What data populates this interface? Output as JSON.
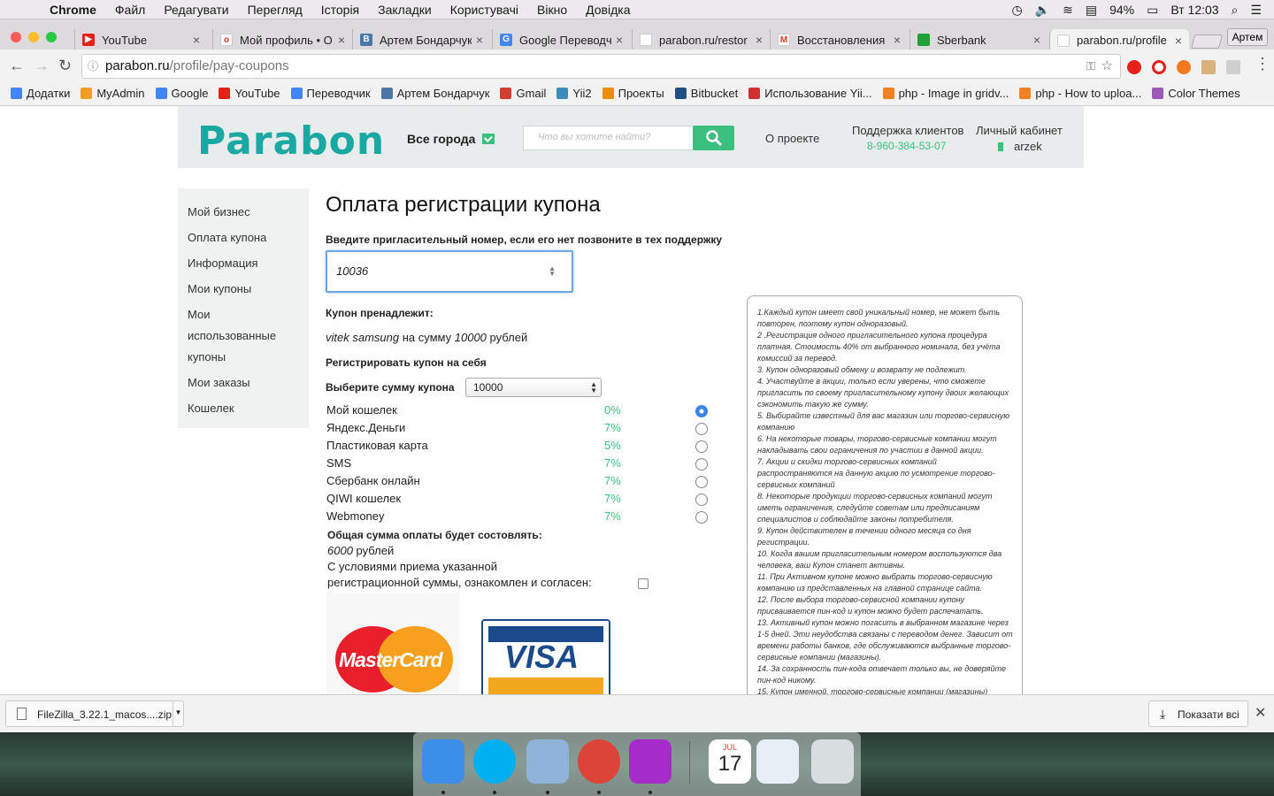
{
  "menubar": {
    "app": "Chrome",
    "items": [
      "Файл",
      "Редагувати",
      "Перегляд",
      "Історія",
      "Закладки",
      "Користувачі",
      "Вікно",
      "Довідка"
    ],
    "battery": "94%",
    "clock": "Вт 12:03"
  },
  "tabs": [
    {
      "label": "YouTube",
      "icon": "youtube-icon",
      "color": "#e62117",
      "glyph": "▶"
    },
    {
      "label": "Мой профиль • O",
      "icon": "olx-icon",
      "color": "#ffffff",
      "glyph": "o"
    },
    {
      "label": "Артем Бондарчук",
      "icon": "vk-icon",
      "color": "#4a76a8",
      "glyph": "В"
    },
    {
      "label": "Google Переводч",
      "icon": "google-translate-icon",
      "color": "#4285f4",
      "glyph": "G"
    },
    {
      "label": "parabon.ru/restor",
      "icon": "parabon-icon",
      "color": "#ffffff",
      "glyph": ""
    },
    {
      "label": "Восстановления",
      "icon": "gmail-icon",
      "color": "#ffffff",
      "glyph": "M"
    },
    {
      "label": "Sberbank",
      "icon": "sberbank-icon",
      "color": "#21a038",
      "glyph": ""
    },
    {
      "label": "parabon.ru/profile",
      "icon": "parabon-icon",
      "color": "#ffffff",
      "glyph": "",
      "active": true
    }
  ],
  "profile_button": "Артем",
  "address": {
    "host": "parabon.ru",
    "path": "/profile/pay-coupons"
  },
  "bookmarks": [
    {
      "label": "Додатки",
      "icon": "apps-icon",
      "color": "#4285f4"
    },
    {
      "label": "MyAdmin",
      "icon": "myadmin-icon",
      "color": "#f0a020"
    },
    {
      "label": "Google",
      "icon": "google-icon",
      "color": "#4285f4"
    },
    {
      "label": "YouTube",
      "icon": "youtube-icon",
      "color": "#e62117"
    },
    {
      "label": "Переводчик",
      "icon": "translate-icon",
      "color": "#4285f4"
    },
    {
      "label": "Артем Бондарчук",
      "icon": "vk-icon",
      "color": "#4a76a8"
    },
    {
      "label": "Gmail",
      "icon": "gmail-icon",
      "color": "#d23f31"
    },
    {
      "label": "Yii2",
      "icon": "yii-icon",
      "color": "#3c8dbc"
    },
    {
      "label": "Проекты",
      "icon": "stack-icon",
      "color": "#f08c00"
    },
    {
      "label": "Bitbucket",
      "icon": "bitbucket-icon",
      "color": "#205081"
    },
    {
      "label": "Использование Yii...",
      "icon": "sk-icon",
      "color": "#d0302f"
    },
    {
      "label": "php - Image in gridv...",
      "icon": "stackoverflow-icon",
      "color": "#f48024"
    },
    {
      "label": "php - How to uploa...",
      "icon": "stackoverflow-icon",
      "color": "#f48024"
    },
    {
      "label": "Color Themes",
      "icon": "color-themes-icon",
      "color": "#9b59b6"
    }
  ],
  "site": {
    "logo": "Parabon",
    "city": "Все города",
    "search_placeholder": "Что вы хотите найти?",
    "about": "О проекте",
    "support_label": "Поддержка клиентов",
    "support_phone": "8-960-384-53-07",
    "cabinet_label": "Личный кабинет",
    "username": "arzek"
  },
  "sidebar": [
    "Мой бизнес",
    "Оплата купона",
    "Информация",
    "Мои купоны",
    "Мои использованные купоны",
    "Мои заказы",
    "Кошелек"
  ],
  "form": {
    "title": "Оплата регистрации купона",
    "hint": "Введите пригласительный номер, если его нет позвоните в тех поддержку",
    "code_value": "10036",
    "owner_label": "Купон пренадлежит:",
    "owner_name": "vitek samsung",
    "owner_mid": "на сумму",
    "owner_amount": "10000",
    "owner_currency": "рублей",
    "self_register": "Регистрировать купон на себя",
    "amount_label": "Выберите сумму купона",
    "amount_value": "10000",
    "payments": [
      {
        "name": "Мой кошелек",
        "pct": "0%",
        "selected": true
      },
      {
        "name": "Яндекс.Деньги",
        "pct": "7%",
        "selected": false
      },
      {
        "name": "Пластиковая карта",
        "pct": "5%",
        "selected": false
      },
      {
        "name": "SMS",
        "pct": "7%",
        "selected": false
      },
      {
        "name": "Сбербанк онлайн",
        "pct": "7%",
        "selected": false
      },
      {
        "name": "QIWI кошелек",
        "pct": "7%",
        "selected": false
      },
      {
        "name": "Webmoney",
        "pct": "7%",
        "selected": false
      }
    ],
    "total_label": "Общая сумма оплаты будет состовлять:",
    "total_value": "6000",
    "total_currency": "рублей",
    "agree_line1": "С условиями приема указанной",
    "agree_line2": "регистрационной суммы, ознакомлен и согласен:",
    "mastercard": "MasterCard",
    "visa": "VISA"
  },
  "terms": [
    "1.Каждый купон имеет свой уникальный номер, не может быть повторен, поэтому купон одноразовый.",
    "2 .Регистрация одного пригласительного купона процедура платная. Стоимость 40% от выбранного номинала, без учёта комиссий за перевод.",
    "3. Купон одноразовый обмену и возврату не подлежит.",
    "4. Участвуйте в акции, только если уверены, что сможете пригласить по своему пригласительному купону двоих желающих сэкономить такую же сумму.",
    "5. Выбирайте известный для вас магазин или торгово-сервисную компанию",
    "6. На некоторые товары, торгово-сервисные компании могут накладывать свои ограничения по участии в данной акции.",
    "7. Акции и скидки торгово-сервисных компаний распространяются на данную акцию по усмотрение торгово-сервисных компаний",
    "8. Некоторые продукции торгово-сервисных компаний могут иметь ограничения, следуйте советам или предписаниям специалистов и соблюдайте законы потребителя.",
    "9. Купон действителен в течении одного месяца со дня регистрации.",
    "10. Когда вашим пригласительным номером воспользуются два человека, ваш Купон станет активны.",
    "11. При Активном купоне можно выбрать торгово-сервисную компанию из представленных на главной странице сайта.",
    "12. После выбора торгово-сервисной компании купону присваивается пин-код и купон можно будет распечатать.",
    "13. Активный купон можно погасить в выбранном магазине через 1-5 дней. Эти неудобства связаны с переводом денег. Зависит от времени работы банков, где обслуживаются выбранные торгово-сервисные компании (магазины).",
    "14. За сохранность пин-кода отвечает только вы, не доверяйте пин-код никому.",
    "15. Купон именной, торгово-сервисные компании (магазины)"
  ],
  "downloads": {
    "file": "FileZilla_3.22.1_macos....zip",
    "show_all": "Показати всі"
  },
  "dock": [
    {
      "name": "finder-icon",
      "color": "#3b8fe8"
    },
    {
      "name": "skype-icon",
      "color": "#00aff0"
    },
    {
      "name": "mail-icon",
      "color": "#8fb3d9"
    },
    {
      "name": "chrome-icon",
      "color": "#db4437"
    },
    {
      "name": "phpstorm-icon",
      "color": "#a52cc9"
    },
    {
      "name": "calendar-icon",
      "color": "#ffffff",
      "month": "JUL",
      "day": "17"
    },
    {
      "name": "preview-icon",
      "color": "#e8eef5"
    },
    {
      "name": "trash-icon",
      "color": "#d8dde0"
    }
  ]
}
